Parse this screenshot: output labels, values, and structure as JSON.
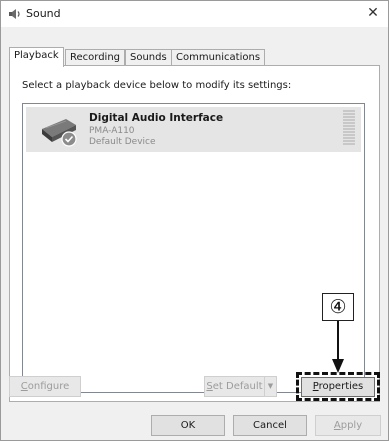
{
  "window": {
    "title": "Sound",
    "close_glyph": "✕",
    "title_icon": "speaker-icon"
  },
  "tabs": [
    {
      "label": "Playback",
      "active": true
    },
    {
      "label": "Recording",
      "active": false
    },
    {
      "label": "Sounds",
      "active": false
    },
    {
      "label": "Communications",
      "active": false
    }
  ],
  "playback": {
    "instructions": "Select a playback device below to modify its settings:",
    "devices": [
      {
        "name": "Digital Audio Interface",
        "model": "PMA-A110",
        "status": "Default Device",
        "icon": "digital-audio-device-icon",
        "badge_icon": "default-checkmark-icon"
      }
    ],
    "buttons": {
      "configure": {
        "underline": "C",
        "rest": "onfigure",
        "enabled": false
      },
      "set_default": {
        "underline": "S",
        "rest": "et Default",
        "enabled": false
      },
      "set_default_arrow": "▼",
      "properties": {
        "underline": "P",
        "rest": "roperties",
        "enabled": true
      }
    }
  },
  "annotation": {
    "step": "④"
  },
  "footer": {
    "ok": "OK",
    "cancel": "Cancel",
    "apply": {
      "underline": "A",
      "rest": "pply",
      "enabled": false
    }
  },
  "colors": {
    "selection": "#e5e5e5",
    "window_bg": "#f0f0f0",
    "disabled_text": "#9c9c9c"
  }
}
